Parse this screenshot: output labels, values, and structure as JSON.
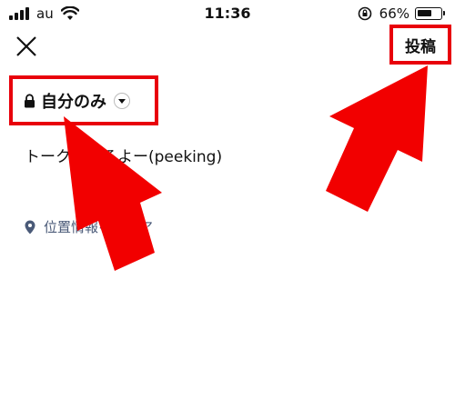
{
  "status_bar": {
    "carrier": "au",
    "time": "11:36",
    "battery_percent": "66%",
    "battery_level": 0.66
  },
  "header": {
    "close_icon": "close-icon",
    "post_label": "投稿"
  },
  "privacy": {
    "label": "自分のみ",
    "lock_icon": "lock-icon",
    "dropdown_icon": "chevron-down-icon"
  },
  "post": {
    "text": "トーク送するよー(peeking)"
  },
  "location": {
    "label": "位置情報をシェア",
    "icon": "location-pin-icon"
  },
  "annotations": {
    "highlight_color": "#e8000b"
  }
}
